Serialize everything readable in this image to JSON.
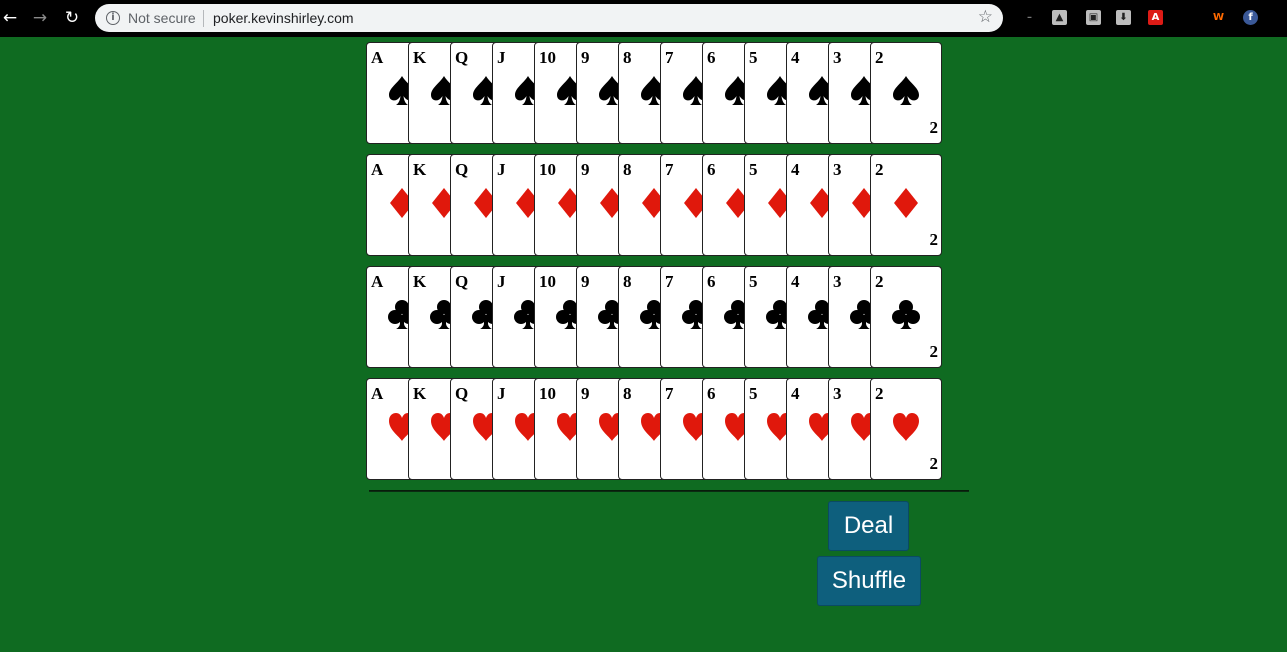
{
  "browser": {
    "security_label": "Not secure",
    "url": "poker.kevinshirley.com",
    "back_icon": "←",
    "forward_icon": "→",
    "reload_icon": "↻",
    "star_icon": "☆",
    "info_icon": "i"
  },
  "extensions": [
    {
      "name": "minimize-icon",
      "glyph": "–",
      "color": "#000000"
    },
    {
      "name": "drive-icon",
      "glyph": "▲",
      "color": "#000000"
    },
    {
      "name": "image-extension-icon",
      "glyph": "▣",
      "color": "#000000"
    },
    {
      "name": "download-extension-icon",
      "glyph": "⬇",
      "color": "#000000"
    },
    {
      "name": "angular-icon",
      "glyph": "A",
      "color": "#dd1b16"
    },
    {
      "name": "wappalyzer-icon",
      "glyph": "W",
      "color": "#ff6a00"
    },
    {
      "name": "facebook-icon",
      "glyph": "f",
      "color": "#3b5998"
    }
  ],
  "suits": [
    {
      "name": "spades",
      "symbol": "♠",
      "color": "#000000"
    },
    {
      "name": "diamonds",
      "symbol": "♦",
      "color": "#e0180c"
    },
    {
      "name": "clubs",
      "symbol": "♣",
      "color": "#000000"
    },
    {
      "name": "hearts",
      "symbol": "♥",
      "color": "#e0180c"
    }
  ],
  "ranks": [
    "A",
    "K",
    "Q",
    "J",
    "10",
    "9",
    "8",
    "7",
    "6",
    "5",
    "4",
    "3",
    "2"
  ],
  "last_card_corner_rank": "2",
  "buttons": {
    "deal_label": "Deal",
    "shuffle_label": "Shuffle"
  },
  "colors": {
    "table_green": "#0f6b21",
    "button_blue": "#0e5f7d"
  }
}
